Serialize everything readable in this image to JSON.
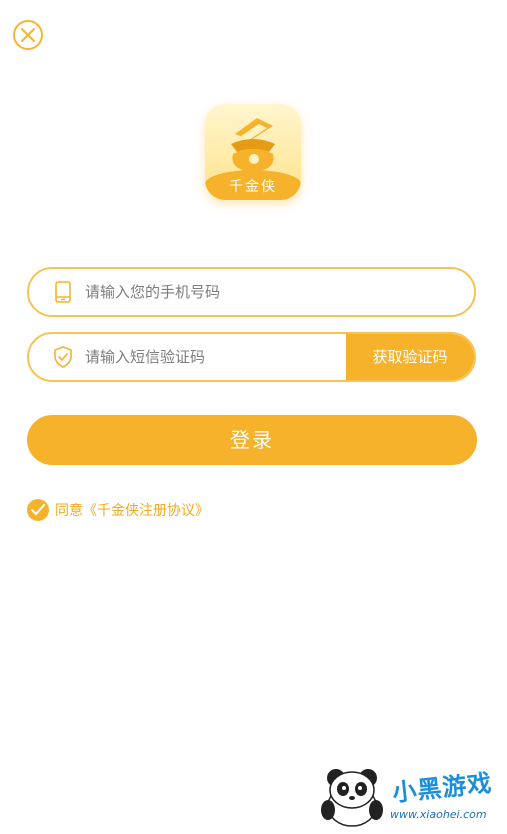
{
  "close": {
    "icon": "close-icon"
  },
  "app": {
    "icon_label": "千金侠",
    "icon_name": "gold-bag-app-icon"
  },
  "phone": {
    "placeholder": "请输入您的手机号码",
    "icon": "phone-icon"
  },
  "code": {
    "placeholder": "请输入短信验证码",
    "icon": "shield-icon",
    "button_label": "获取验证码"
  },
  "login": {
    "label": "登录"
  },
  "agreement": {
    "text": "同意《千金侠注册协议》",
    "checked": true
  },
  "watermark": {
    "brand": "小黑游戏",
    "url": "www.xiaohei.com"
  },
  "colors": {
    "accent": "#f7b22c",
    "border": "#f7c355",
    "link": "#f4a91e"
  }
}
